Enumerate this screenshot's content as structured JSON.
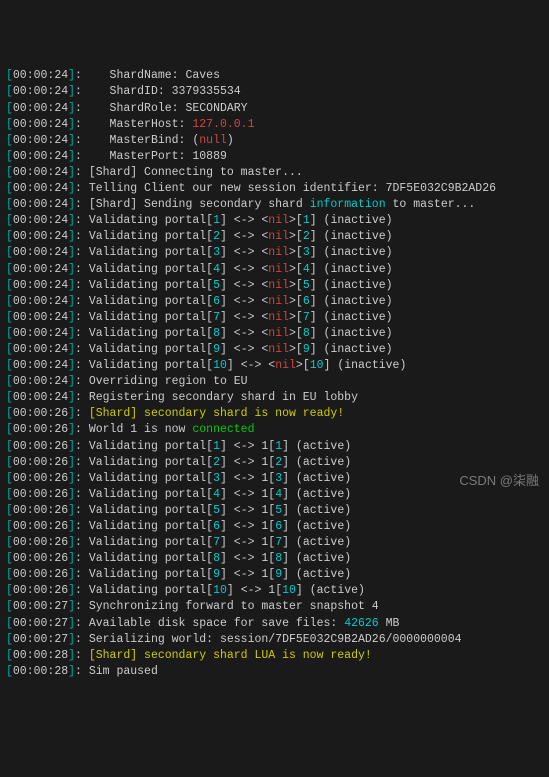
{
  "timestamps": {
    "t24": "00:00:24",
    "t26": "00:00:26",
    "t27": "00:00:27",
    "t28": "00:00:28"
  },
  "config": {
    "shard_name_label": "ShardName",
    "shard_name_value": "Caves",
    "shard_id_label": "ShardID",
    "shard_id_value": "3379335534",
    "shard_role_label": "ShardRole",
    "shard_role_value": "SECONDARY",
    "master_host_label": "MasterHost",
    "master_host_value": "127.0.0.1",
    "master_bind_label": "MasterBind",
    "master_bind_value": "null",
    "master_port_label": "MasterPort",
    "master_port_value": "10889"
  },
  "messages": {
    "connecting": "[Shard] Connecting to master...",
    "telling_prefix": "Telling Client our new session identifier: ",
    "session_id": "7DF5E032C9B2AD26",
    "sending_prefix": "[Shard] Sending secondary shard ",
    "information": "information",
    "sending_suffix": " to master...",
    "validating": "Validating portal",
    "nil": "nil",
    "arrow": "<->",
    "inactive": "(inactive)",
    "active": "(active)",
    "override": "Overriding region to EU",
    "registering": "Registering secondary shard in EU lobby",
    "shard_ready": "[Shard] secondary shard is now ready!",
    "world_prefix": "World 1 is now ",
    "connected": "connected",
    "sync": "Synchronizing forward to master snapshot 4",
    "disk_prefix": "Available disk space for save files: ",
    "disk_value": "42626",
    "disk_suffix": " MB",
    "serializing_prefix": "Serializing world: ",
    "serializing_path": "session/7DF5E032C9B2AD26/0000000004",
    "shard_lua_ready": "[Shard] secondary shard LUA is now ready!",
    "sim_paused": "Sim paused"
  },
  "portals_inactive": [
    {
      "idx": "1"
    },
    {
      "idx": "2"
    },
    {
      "idx": "3"
    },
    {
      "idx": "4"
    },
    {
      "idx": "5"
    },
    {
      "idx": "6"
    },
    {
      "idx": "7"
    },
    {
      "idx": "8"
    },
    {
      "idx": "9"
    },
    {
      "idx": "10"
    }
  ],
  "portals_active": [
    {
      "idx": "1"
    },
    {
      "idx": "2"
    },
    {
      "idx": "3"
    },
    {
      "idx": "4"
    },
    {
      "idx": "5"
    },
    {
      "idx": "6"
    },
    {
      "idx": "7"
    },
    {
      "idx": "8"
    },
    {
      "idx": "9"
    },
    {
      "idx": "10"
    }
  ],
  "watermark": "CSDN @柒融"
}
